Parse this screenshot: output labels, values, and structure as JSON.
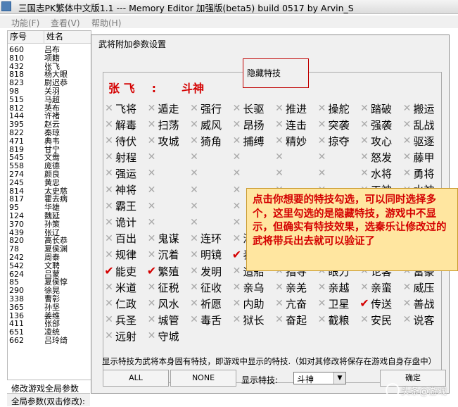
{
  "window": {
    "title": "三国志PK繁体中文版1.1 --- Memory Editor 加强版(beta5) build 0517 by Arvin_S"
  },
  "menu": [
    "功能(F)",
    "查看(V)",
    "帮助(H)"
  ],
  "list": {
    "headers": [
      "序号",
      "姓名"
    ],
    "rows": [
      [
        "660",
        "吕布"
      ],
      [
        "810",
        "项籍"
      ],
      [
        "432",
        "张飞"
      ],
      [
        "818",
        "杨大眼"
      ],
      [
        "823",
        "尉迟恭"
      ],
      [
        "98",
        "关羽"
      ],
      [
        "515",
        "马超"
      ],
      [
        "812",
        "英布"
      ],
      [
        "144",
        "许褚"
      ],
      [
        "395",
        "赵云"
      ],
      [
        "822",
        "秦琼"
      ],
      [
        "471",
        "典韦"
      ],
      [
        "819",
        "甘宁"
      ],
      [
        "545",
        "文鸯"
      ],
      [
        "558",
        "庞德"
      ],
      [
        "274",
        "颜良"
      ],
      [
        "245",
        "黄忠"
      ],
      [
        "814",
        "太史慈"
      ],
      [
        "817",
        "霍去病"
      ],
      [
        "95",
        "华雄"
      ],
      [
        "124",
        "魏延"
      ],
      [
        "370",
        "孙策"
      ],
      [
        "439",
        "张辽"
      ],
      [
        "820",
        "高长恭"
      ],
      [
        "78",
        "夏侯渊"
      ],
      [
        "242",
        "周泰"
      ],
      [
        "542",
        "文聘"
      ],
      [
        "624",
        "吕蒙"
      ],
      [
        "85",
        "夏侯惇"
      ],
      [
        "290",
        "徐晃"
      ],
      [
        "338",
        "曹彰"
      ],
      [
        "365",
        "孙坚"
      ],
      [
        "136",
        "姜维"
      ],
      [
        "411",
        "张郃"
      ],
      [
        "651",
        "凌统"
      ],
      [
        "662",
        "吕玲绮"
      ]
    ]
  },
  "global": {
    "label": "修改游戏全局参数",
    "sub": "全局参数(双击修改):"
  },
  "dialog": {
    "title": "武将附加参数设置",
    "hidden_label": "隐藏特技",
    "general_name": "张 飞",
    "colon": ":",
    "general_skill": "斗神",
    "skills": [
      {
        "label": "飞将",
        "checked": false
      },
      {
        "label": "遁走",
        "checked": false
      },
      {
        "label": "强行",
        "checked": false
      },
      {
        "label": "长驱",
        "checked": false
      },
      {
        "label": "推进",
        "checked": false
      },
      {
        "label": "操舵",
        "checked": false
      },
      {
        "label": "踏破",
        "checked": false
      },
      {
        "label": "搬运",
        "checked": false
      },
      {
        "label": "解毒",
        "checked": false
      },
      {
        "label": "扫荡",
        "checked": false
      },
      {
        "label": "威风",
        "checked": false
      },
      {
        "label": "昂扬",
        "checked": false
      },
      {
        "label": "连击",
        "checked": false
      },
      {
        "label": "突袭",
        "checked": false
      },
      {
        "label": "强袭",
        "checked": false
      },
      {
        "label": "乱战",
        "checked": false
      },
      {
        "label": "待伏",
        "checked": false
      },
      {
        "label": "攻城",
        "checked": false
      },
      {
        "label": "猗角",
        "checked": false
      },
      {
        "label": "捕缚",
        "checked": false
      },
      {
        "label": "精妙",
        "checked": false
      },
      {
        "label": "掠夺",
        "checked": false
      },
      {
        "label": "攻心",
        "checked": false
      },
      {
        "label": "驱逐",
        "checked": false
      },
      {
        "label": "射程",
        "checked": false
      },
      {
        "label": "",
        "checked": false
      },
      {
        "label": "",
        "checked": false
      },
      {
        "label": "",
        "checked": false
      },
      {
        "label": "",
        "checked": false
      },
      {
        "label": "",
        "checked": false
      },
      {
        "label": "怒发",
        "checked": false
      },
      {
        "label": "藤甲",
        "checked": false
      },
      {
        "label": "强运",
        "checked": false
      },
      {
        "label": "",
        "checked": false
      },
      {
        "label": "",
        "checked": false
      },
      {
        "label": "",
        "checked": false
      },
      {
        "label": "",
        "checked": false
      },
      {
        "label": "",
        "checked": false
      },
      {
        "label": "水将",
        "checked": false
      },
      {
        "label": "勇将",
        "checked": false
      },
      {
        "label": "神将",
        "checked": false
      },
      {
        "label": "",
        "checked": false
      },
      {
        "label": "",
        "checked": false
      },
      {
        "label": "",
        "checked": false
      },
      {
        "label": "",
        "checked": false
      },
      {
        "label": "",
        "checked": false
      },
      {
        "label": "工神",
        "checked": false
      },
      {
        "label": "水神",
        "checked": false
      },
      {
        "label": "霸王",
        "checked": false
      },
      {
        "label": "",
        "checked": false
      },
      {
        "label": "",
        "checked": false
      },
      {
        "label": "",
        "checked": false
      },
      {
        "label": "",
        "checked": false
      },
      {
        "label": "",
        "checked": false
      },
      {
        "label": "言毒",
        "checked": false
      },
      {
        "label": "机智",
        "checked": false
      },
      {
        "label": "诡计",
        "checked": false
      },
      {
        "label": "",
        "checked": false
      },
      {
        "label": "",
        "checked": false
      },
      {
        "label": "",
        "checked": false
      },
      {
        "label": "",
        "checked": false
      },
      {
        "label": "",
        "checked": false
      },
      {
        "label": "火神",
        "checked": false
      },
      {
        "label": "神算",
        "checked": false
      },
      {
        "label": "百出",
        "checked": false
      },
      {
        "label": "鬼谋",
        "checked": false
      },
      {
        "label": "连环",
        "checked": false
      },
      {
        "label": "深谋",
        "checked": false
      },
      {
        "label": "反计",
        "checked": false
      },
      {
        "label": "倾国",
        "checked": false
      },
      {
        "label": "妖术",
        "checked": false
      },
      {
        "label": "鬼门",
        "checked": false
      },
      {
        "label": "规律",
        "checked": false
      },
      {
        "label": "沉着",
        "checked": false
      },
      {
        "label": "明镜",
        "checked": false
      },
      {
        "label": "奏乐",
        "checked": true
      },
      {
        "label": "诗想",
        "checked": false
      },
      {
        "label": "筑城",
        "checked": false
      },
      {
        "label": "屯田",
        "checked": false
      },
      {
        "label": "名声",
        "checked": false
      },
      {
        "label": "能吏",
        "checked": true
      },
      {
        "label": "繁殖",
        "checked": true
      },
      {
        "label": "发明",
        "checked": false
      },
      {
        "label": "造船",
        "checked": false
      },
      {
        "label": "指导",
        "checked": false
      },
      {
        "label": "眼力",
        "checked": false
      },
      {
        "label": "论客",
        "checked": false
      },
      {
        "label": "富豪",
        "checked": false
      },
      {
        "label": "米道",
        "checked": false
      },
      {
        "label": "征税",
        "checked": false
      },
      {
        "label": "征收",
        "checked": false
      },
      {
        "label": "亲乌",
        "checked": false
      },
      {
        "label": "亲羌",
        "checked": false
      },
      {
        "label": "亲越",
        "checked": false
      },
      {
        "label": "亲蛮",
        "checked": false
      },
      {
        "label": "威压",
        "checked": false
      },
      {
        "label": "仁政",
        "checked": false
      },
      {
        "label": "风水",
        "checked": false
      },
      {
        "label": "祈愿",
        "checked": false
      },
      {
        "label": "内助",
        "checked": false
      },
      {
        "label": "亢奋",
        "checked": false
      },
      {
        "label": "卫星",
        "checked": false
      },
      {
        "label": "传送",
        "checked": true
      },
      {
        "label": "善战",
        "checked": false
      },
      {
        "label": "兵圣",
        "checked": false
      },
      {
        "label": "城管",
        "checked": false
      },
      {
        "label": "毒舌",
        "checked": false
      },
      {
        "label": "狱长",
        "checked": false
      },
      {
        "label": "奋起",
        "checked": false
      },
      {
        "label": "截粮",
        "checked": false
      },
      {
        "label": "安民",
        "checked": false
      },
      {
        "label": "说客",
        "checked": false
      },
      {
        "label": "远射",
        "checked": false
      },
      {
        "label": "守城",
        "checked": false
      }
    ],
    "tooltip": "点击你想要的特技勾选，可以同时选择多个，这里勾选的是隐藏特技，游戏中不显示，但确实有特技效果，选秦乐让修改过的武将带兵出去就可以验证了",
    "description": "显示特技为武将本身固有特技，即游戏中显示的特技.（如对其修改将保存在游戏自身存盘中）",
    "buttons": {
      "all": "ALL",
      "none": "NONE",
      "ok": "确定"
    },
    "show_label": "显示特技:",
    "show_value": "斗神"
  },
  "watermark": "头条@游戏"
}
